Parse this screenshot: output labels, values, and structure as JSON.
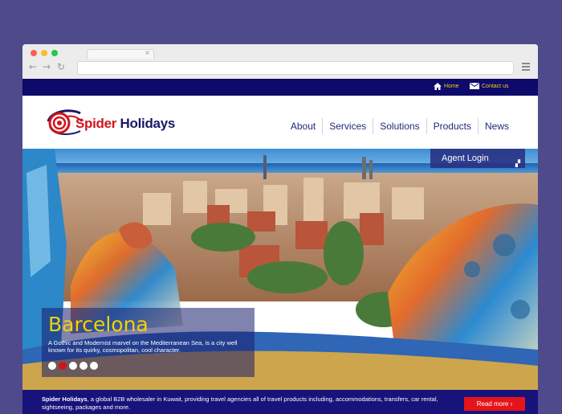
{
  "browser": {
    "tab_close": "×",
    "back_icon": "←",
    "forward_icon": "→",
    "reload_icon": "↻",
    "traffic_lights": [
      "#ff5f57",
      "#febc2e",
      "#28c840"
    ]
  },
  "topbar": {
    "home_label": "Home",
    "contact_label": "Contact us",
    "bg_color": "#0d0a6b",
    "link_color": "#f3d400"
  },
  "logo": {
    "word1": "Spider",
    "word2": "Holidays"
  },
  "nav": {
    "items": [
      "About",
      "Services",
      "Solutions",
      "Products",
      "News"
    ]
  },
  "hero": {
    "agent_login": "Agent Login",
    "title": "Barcelona",
    "description": "A Gothic and Modernist marvel on the Mediterranean Sea, is a city well known for its quirky, cosmopolitan, cool character.",
    "slide_count": 5,
    "active_slide": 2
  },
  "intro": {
    "company": "Spider Holidays",
    "text": ", a global B2B wholesaler in Kuwait, providing travel agencies all of travel products including, accommodations, transfers, car rental, sightseeing, packages and more.",
    "read_more": "Read more"
  },
  "colors": {
    "page_bg": "#4e4a8c",
    "brand_red": "#d0151a",
    "brand_navy": "#1a1764",
    "title_yellow": "#f5d100"
  }
}
